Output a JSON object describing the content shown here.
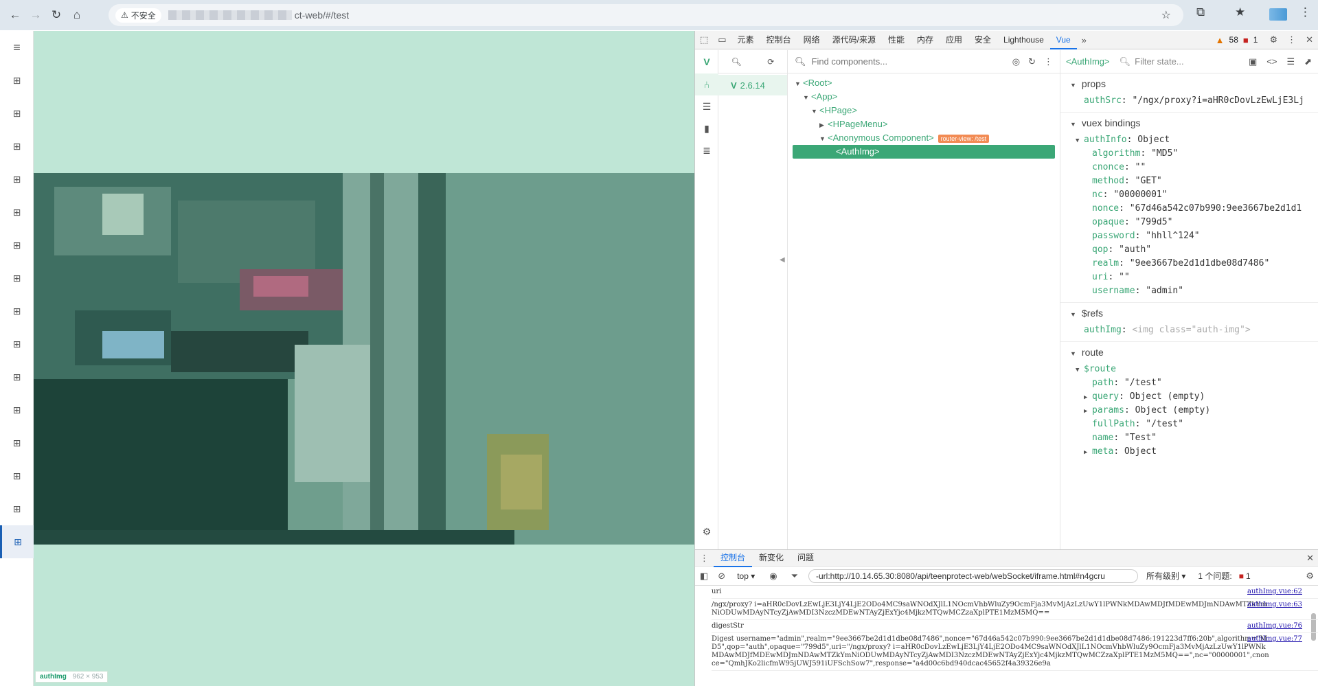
{
  "browser": {
    "insecure_label": "不安全",
    "url_suffix": "ct-web/#/test"
  },
  "leftbar": {
    "menu_icon": "hamburger-icon",
    "item_count": 15,
    "item_icon": "grid-icon"
  },
  "main": {
    "element_tag": "authImg",
    "element_size": "962 × 953"
  },
  "devtools": {
    "tabs": [
      "元素",
      "控制台",
      "网络",
      "源代码/来源",
      "性能",
      "内存",
      "应用",
      "安全",
      "Lighthouse",
      "Vue"
    ],
    "active_tab": "Vue",
    "warning_count": "58",
    "error_count": "1"
  },
  "vue": {
    "version": "2.6.14",
    "search_placeholder": "Find components...",
    "selected_component": "<AuthImg>",
    "filter_placeholder": "Filter state...",
    "tree": [
      {
        "label": "<Root>",
        "arrow": "▼",
        "indent": 0
      },
      {
        "label": "<App>",
        "arrow": "▼",
        "indent": 1
      },
      {
        "label": "<HPage>",
        "arrow": "▼",
        "indent": 2
      },
      {
        "label": "<HPageMenu>",
        "arrow": "▶",
        "indent": 3
      },
      {
        "label": "<Anonymous Component>",
        "arrow": "▼",
        "indent": 3,
        "tag": "router-view: /test"
      },
      {
        "label": "<AuthImg>",
        "arrow": "",
        "indent": 4,
        "selected": true
      }
    ],
    "props_title": "props",
    "props": [
      {
        "key": "authSrc",
        "value": "\"/ngx/proxy?i=aHR0cDovLzEwLjE3Lj"
      }
    ],
    "vuex_title": "vuex bindings",
    "authinfo_key": "authInfo",
    "authinfo_type": "Object",
    "authinfo": [
      {
        "key": "algorithm",
        "value": "\"MD5\""
      },
      {
        "key": "cnonce",
        "value": "\"\""
      },
      {
        "key": "method",
        "value": "\"GET\""
      },
      {
        "key": "nc",
        "value": "\"00000001\""
      },
      {
        "key": "nonce",
        "value": "\"67d46a542c07b990:9ee3667be2d1d1"
      },
      {
        "key": "opaque",
        "value": "\"799d5\""
      },
      {
        "key": "password",
        "value": "\"hhll^124\""
      },
      {
        "key": "qop",
        "value": "\"auth\""
      },
      {
        "key": "realm",
        "value": "\"9ee3667be2d1d1dbe08d7486\""
      },
      {
        "key": "uri",
        "value": "\"\""
      },
      {
        "key": "username",
        "value": "\"admin\""
      }
    ],
    "refs_title": "$refs",
    "refs": [
      {
        "key": "authImg",
        "value": "<img class=\"auth-img\">"
      }
    ],
    "route_title": "route",
    "route_key": "$route",
    "route": [
      {
        "key": "path",
        "value": "\"/test\"",
        "arrow": ""
      },
      {
        "key": "query",
        "value": "Object (empty)",
        "arrow": "▶"
      },
      {
        "key": "params",
        "value": "Object (empty)",
        "arrow": "▶"
      },
      {
        "key": "fullPath",
        "value": "\"/test\"",
        "arrow": ""
      },
      {
        "key": "name",
        "value": "\"Test\"",
        "arrow": ""
      },
      {
        "key": "meta",
        "value": "Object",
        "arrow": "▶"
      }
    ]
  },
  "console": {
    "tabs": [
      "控制台",
      "新变化",
      "问题"
    ],
    "context": "top",
    "filter_value": "-url:http://10.14.65.30:8080/api/teenprotect-web/webSocket/iframe.html#n4gcru",
    "levels": "所有级别",
    "issues_label": "1 个问题:",
    "issues_count": "1",
    "logs": [
      {
        "text": "uri",
        "src": "authImg.vue:62"
      },
      {
        "text": "/ngx/proxy? i=aHR0cDovLzEwLjE3LjY4LjE2ODo4MC9saWNOdXJlL1NOcmVhbWluZy9OcmFja3MvMjAzLzUwY1lPWNkMDAwMDJfMDEwMDJmNDAwMTZkYmNiODUwMDAyNTcyZjAwMDI3NzczMDEwNTAyZjExYjc4MjkzMTQwMCZzaXplPTE1MzM5MQ==",
        "src": "authImg.vue:63"
      },
      {
        "text": "digestStr",
        "src": "authImg.vue:76"
      },
      {
        "text": "Digest username=\"admin\",realm=\"9ee3667be2d1d1dbe08d7486\",nonce=\"67d46a542c07b990:9ee3667be2d1d1dbe08d7486:191223d7ff6:20b\",algorithm=\"MD5\",qop=\"auth\",opaque=\"799d5\",uri=\"/ngx/proxy? i=aHR0cDovLzEwLjE3LjY4LjE2ODo4MC9saWNOdXJlL1NOcmVhbWluZy9OcmFja3MvMjAzLzUwY1lPWNkMDAwMDJfMDEwMDJmNDAwMTZkYmNiODUwMDAyNTcyZjAwMDI3NzczMDEwNTAyZjExYjc4MjkzMTQwMCZzaXplPTE1MzM5MQ==\",nc=\"00000001\",cnonce=\"QmhJKo2licfmW95jUWJ591iUFSchSow7\",response=\"a4d00c6bd940dcac45652f4a39326e9a",
        "src": "authImg.vue:77"
      }
    ]
  }
}
